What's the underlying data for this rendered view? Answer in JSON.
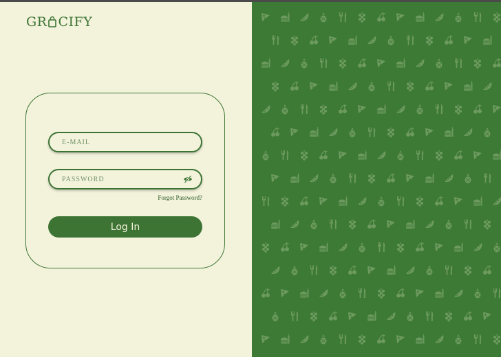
{
  "brand": {
    "name_start": "GR",
    "name_end": "CIFY",
    "logo_icon": "shopping-bag-icon"
  },
  "login": {
    "email_placeholder": "E-MAIL",
    "password_placeholder": "PASSWORD",
    "password_toggle_icon": "eye-slash-icon",
    "forgot_label": "Forgot Password?",
    "submit_label": "Log In"
  },
  "pattern": {
    "icons": [
      "pizza-slice-icon",
      "grapes-icon",
      "pineapple-icon",
      "burger-drink-icon",
      "cherries-icon",
      "fork-knife-icon",
      "watermelon-icon"
    ]
  },
  "colors": {
    "primary_green": "#3d7434",
    "cream_background": "#f3f3dc",
    "pattern_background": "#3d7a35",
    "pattern_icon": "#6c9a5f"
  }
}
